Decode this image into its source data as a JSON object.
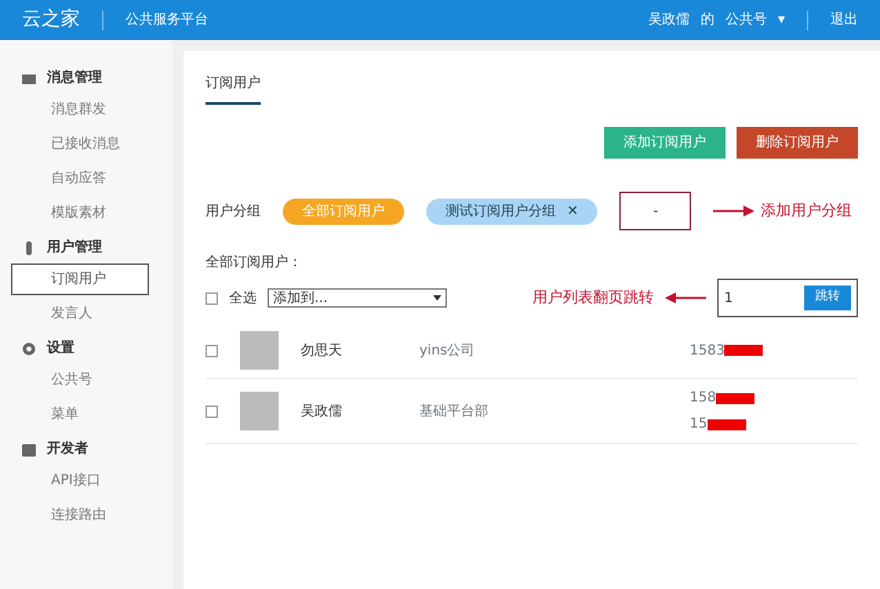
{
  "header": {
    "logo": "云之家",
    "platform": "公共服务平台",
    "account_owner": "吴政儒",
    "account_of": "的",
    "account": "公共号",
    "caret": "▾",
    "logout": "退出"
  },
  "sidebar": [
    {
      "title": "消息管理",
      "kind": "mail",
      "items": [
        {
          "label": "消息群发",
          "selected": false
        },
        {
          "label": "已接收消息",
          "selected": false
        },
        {
          "label": "自动应答",
          "selected": false
        },
        {
          "label": "模版素材",
          "selected": false
        }
      ]
    },
    {
      "title": "用户管理",
      "kind": "user",
      "items": [
        {
          "label": "订阅用户",
          "selected": true
        },
        {
          "label": "发言人",
          "selected": false
        }
      ]
    },
    {
      "title": "设置",
      "kind": "gear",
      "items": [
        {
          "label": "公共号",
          "selected": false
        },
        {
          "label": "菜单",
          "selected": false
        }
      ]
    },
    {
      "title": "开发者",
      "kind": "box",
      "items": [
        {
          "label": "API接口",
          "selected": false
        },
        {
          "label": "连接路由",
          "selected": false
        }
      ]
    }
  ],
  "tabs": [
    {
      "label": "订阅用户",
      "selected": true
    }
  ],
  "buttons": [
    {
      "label": "添加订阅用户",
      "kind": "add"
    },
    {
      "label": "删除订阅用户",
      "kind": "delete"
    }
  ],
  "groups": {
    "label": "用户分组",
    "items": [
      {
        "label": "全部订阅用户",
        "selected": true
      },
      {
        "label": "测试订阅用户分组",
        "selected": false,
        "remove_mark": "✕"
      }
    ],
    "add_box": "-",
    "annotation": "添加用户分组"
  },
  "list_title": "全部订阅用户：",
  "toolbar": {
    "select_all": "全选",
    "select_all_checked": false,
    "dropdown": "添加到...",
    "annotation": "用户列表翻页跳转",
    "page": "1",
    "jump": "跳转"
  },
  "users": [
    {
      "name": "勿思天",
      "company": "yins公司",
      "phones": [
        "1583"
      ],
      "checked": false
    },
    {
      "name": "吴政儒",
      "company": "基础平台部",
      "phones": [
        "158",
        "15"
      ],
      "checked": false
    }
  ]
}
